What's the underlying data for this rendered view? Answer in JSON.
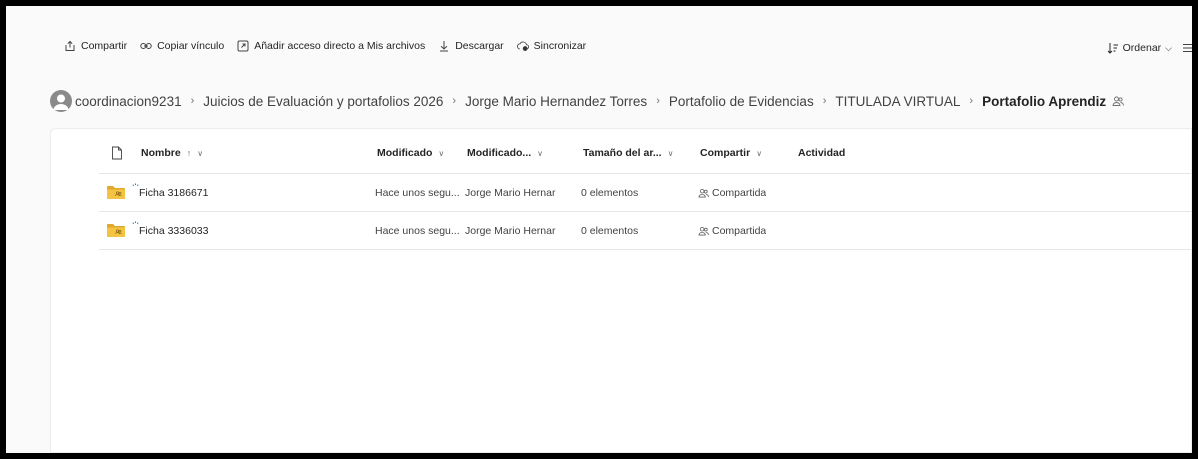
{
  "toolbar": {
    "share_label": "Compartir",
    "copy_link_label": "Copiar vínculo",
    "add_shortcut_label": "Añadir acceso directo a Mis archivos",
    "download_label": "Descargar",
    "sync_label": "Sincronizar",
    "sort_label": "Ordenar"
  },
  "breadcrumb": {
    "items": [
      "coordinacion9231",
      "Juicios de Evaluación y portafolios 2026",
      "Jorge Mario Hernandez Torres",
      "Portafolio de Evidencias",
      "TITULADA VIRTUAL",
      "Portafolio Aprendiz"
    ]
  },
  "columns": {
    "name": "Nombre",
    "name_sort": "↑",
    "modified": "Modificado",
    "modified_by": "Modificado...",
    "size": "Tamaño del ar...",
    "sharing": "Compartir",
    "activity": "Actividad"
  },
  "rows": [
    {
      "name": "Ficha 3186671",
      "modified": "Hace unos segu...",
      "modified_by": "Jorge Mario Hernar",
      "size": "0 elementos",
      "sharing": "Compartida"
    },
    {
      "name": "Ficha 3336033",
      "modified": "Hace unos segu...",
      "modified_by": "Jorge Mario Hernar",
      "size": "0 elementos",
      "sharing": "Compartida"
    }
  ],
  "colors": {
    "folder": "#f5c342",
    "folder_dark": "#e0a82e",
    "sync": "#0f6cbd"
  },
  "icons": [
    "share-icon",
    "link-icon",
    "shortcut-icon",
    "download-icon",
    "sync-icon",
    "sort-icon",
    "menu-icon",
    "avatar-icon",
    "file-icon",
    "folder-icon",
    "shared-people-icon"
  ]
}
